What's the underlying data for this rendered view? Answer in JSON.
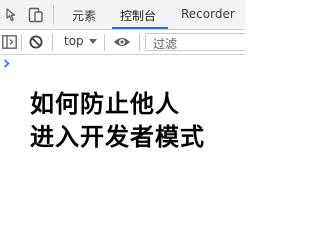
{
  "tabs": [
    {
      "label": "元素"
    },
    {
      "label": "控制台"
    },
    {
      "label": "Recorder"
    }
  ],
  "active_tab": "控制台",
  "toolbar": {
    "context_label": "top",
    "filter_placeholder": "过滤"
  },
  "console": {
    "lines": [
      "如何防止他人",
      "进入开发者模式"
    ]
  },
  "colors": {
    "accent": "#1a73e8",
    "prompt": "#1a73e8"
  },
  "icons": [
    "inspect-cursor-icon",
    "device-toggle-icon",
    "sidebar-toggle-icon",
    "clear-console-icon",
    "context-dropdown-arrow-icon",
    "eye-icon",
    "prompt-chevron-icon"
  ]
}
